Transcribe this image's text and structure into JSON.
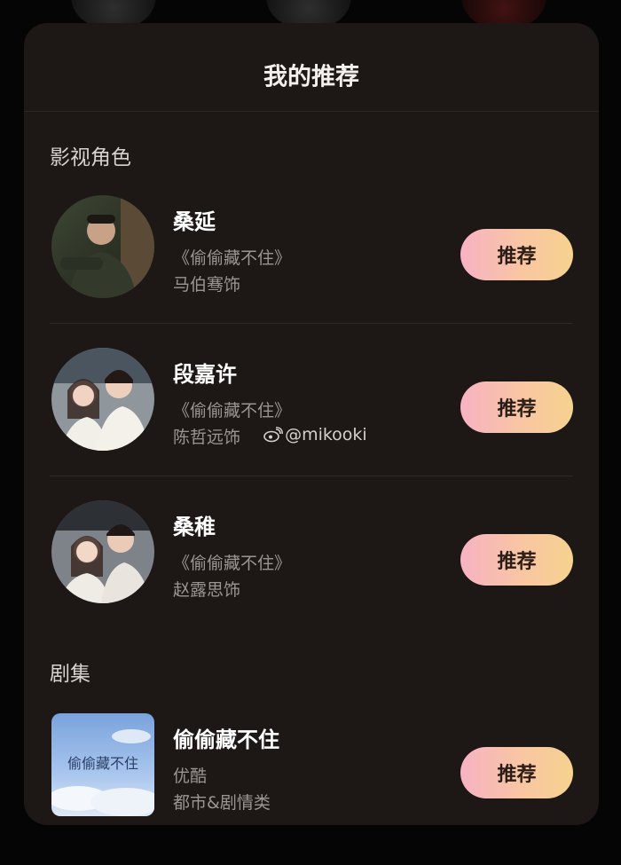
{
  "sheet": {
    "title": "我的推荐"
  },
  "sections": {
    "characters_title": "影视角色",
    "drama_title": "剧集"
  },
  "characters": [
    {
      "name": "桑延",
      "show": "《偷偷藏不住》",
      "actor": "马伯骞饰",
      "button": "推荐",
      "avatar_icon": "actor-photo-icon"
    },
    {
      "name": "段嘉许",
      "show": "《偷偷藏不住》",
      "actor": "陈哲远饰",
      "weibo": "@mikooki",
      "button": "推荐",
      "avatar_icon": "actor-photo-icon"
    },
    {
      "name": "桑稚",
      "show": "《偷偷藏不住》",
      "actor": "赵露思饰",
      "button": "推荐",
      "avatar_icon": "actor-photo-icon"
    }
  ],
  "drama": {
    "title": "偷偷藏不住",
    "platform": "优酷",
    "genre": "都市&剧情类",
    "button": "推荐",
    "poster_text": "偷偷藏不住"
  },
  "colors": {
    "sheet_bg": "#1d1816",
    "button_gradient_start": "#f7b2c4",
    "button_gradient_end": "#f6d28f"
  }
}
